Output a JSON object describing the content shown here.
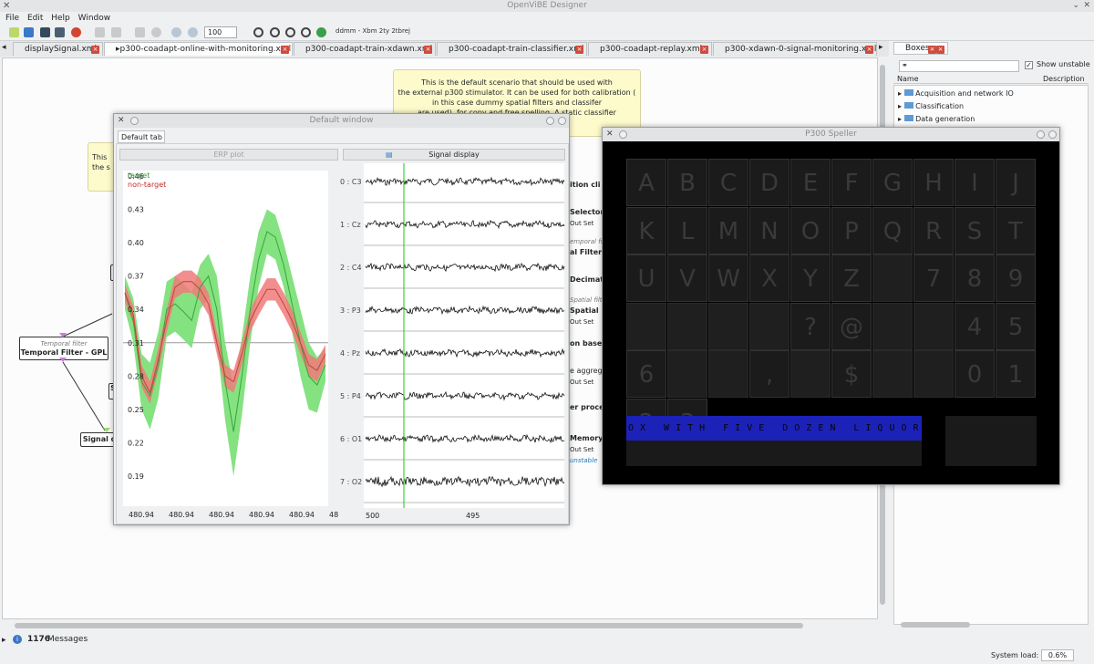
{
  "app": {
    "title": "OpenViBE Designer"
  },
  "menu": {
    "file": "File",
    "edit": "Edit",
    "help": "Help",
    "window": "Window",
    "file_m": "F",
    "file_r": "ile"
  },
  "toolbar": {
    "zoom": "100",
    "time_label": "ddmm - Xbm 2ty 2tbrej"
  },
  "tabs": [
    {
      "label": "displaySignal.xml"
    },
    {
      "label": "▸p300-coadapt-online-with-monitoring.xml"
    },
    {
      "label": "p300-coadapt-train-xdawn.xml"
    },
    {
      "label": "p300-coadapt-train-classifier.xml"
    },
    {
      "label": "p300-coadapt-replay.xml"
    },
    {
      "label": "p300-xdawn-0-signal-monitoring.xml"
    }
  ],
  "scenario": {
    "note_lines": [
      "This is the default scenario that should be used with",
      "the external p300 stimulator. It can be used for both calibration (",
      "in this case dummy spatial filters and classifer",
      "are used), for copy and free spelling. A static classifier"
    ],
    "note2_a": "This",
    "note2_b": "the s",
    "temporal_filter_sub": "Temporal filter",
    "temporal_filter_title": "Temporal Filter - GPL",
    "signal_display_box": "Signal di",
    "partial_boxes": [
      "ition cli",
      "Selector",
      "Out Set",
      "emporal filt",
      "al Filter -",
      "Decimat",
      "Spatial filte",
      "Spatial F",
      "Out Set",
      "on based c",
      "e aggreg",
      "Out Set",
      "er proce",
      "MemoryWriter",
      "Out Set",
      "unstable"
    ],
    "s1": "S",
    "g1": "G"
  },
  "default_window": {
    "title": "Default window",
    "tab": "Default tab",
    "erp_header": "ERP plot",
    "signal_header": "Signal display"
  },
  "chart_data": [
    {
      "type": "line",
      "title": "ERP plot",
      "legend": [
        "target",
        "non-target"
      ],
      "ylabels": [
        "0.46",
        "0.43",
        "0.40",
        "0.37",
        "0.34",
        "0.31",
        "0.28",
        "0.25",
        "0.22",
        "0.19"
      ],
      "xlabels": [
        "480.94",
        "480.94",
        "480.94",
        "480.94",
        "480.94",
        "48"
      ],
      "series": [
        {
          "name": "target",
          "values": [
            0.355,
            0.33,
            0.275,
            0.262,
            0.29,
            0.34,
            0.345,
            0.338,
            0.33,
            0.36,
            0.37,
            0.34,
            0.275,
            0.23,
            0.28,
            0.34,
            0.385,
            0.41,
            0.405,
            0.38,
            0.345,
            0.31,
            0.28,
            0.272,
            0.29
          ],
          "band": [
            0.015,
            0.02,
            0.025,
            0.03,
            0.03,
            0.025,
            0.025,
            0.025,
            0.025,
            0.02,
            0.02,
            0.03,
            0.035,
            0.04,
            0.035,
            0.03,
            0.025,
            0.02,
            0.02,
            0.02,
            0.025,
            0.03,
            0.03,
            0.025,
            0.015
          ]
        },
        {
          "name": "non-target",
          "values": [
            0.355,
            0.335,
            0.28,
            0.265,
            0.295,
            0.33,
            0.36,
            0.365,
            0.365,
            0.358,
            0.345,
            0.31,
            0.28,
            0.275,
            0.3,
            0.33,
            0.345,
            0.358,
            0.358,
            0.345,
            0.33,
            0.31,
            0.29,
            0.285,
            0.3
          ],
          "band": [
            0.008,
            0.008,
            0.01,
            0.01,
            0.01,
            0.01,
            0.01,
            0.01,
            0.01,
            0.01,
            0.01,
            0.01,
            0.01,
            0.01,
            0.01,
            0.01,
            0.01,
            0.01,
            0.01,
            0.01,
            0.01,
            0.01,
            0.01,
            0.01,
            0.008
          ]
        }
      ]
    },
    {
      "type": "line",
      "title": "Signal display",
      "channels": [
        "0 : C3",
        "1 : Cz",
        "2 : C4",
        "3 : P3",
        "4 : Pz",
        "5 : P4",
        "6 : O1",
        "7 : O2"
      ],
      "xlabels": [
        "500",
        "495"
      ]
    }
  ],
  "speller": {
    "title": "P300 Speller",
    "keys": [
      "A",
      "B",
      "C",
      "D",
      "E",
      "F",
      "G",
      "H",
      "I",
      "J",
      "K",
      "L",
      "M",
      "N",
      "O",
      "P",
      "Q",
      "R",
      "S",
      "T",
      "U",
      "V",
      "W",
      "X",
      "Y",
      "Z",
      "",
      "7",
      "8",
      "9",
      "",
      "",
      "",
      "",
      "?",
      "@",
      "",
      "",
      "4",
      "5",
      "6",
      "",
      "",
      ",",
      "",
      "$",
      "",
      "",
      "0",
      "1",
      "2",
      "3"
    ],
    "text": "OX WITH FIVE DOZEN LIQUOR JUGS"
  },
  "boxes_panel": {
    "title": "Boxes",
    "show_unstable": "Show unstable",
    "col_name": "Name",
    "col_desc": "Description",
    "items": [
      "Acquisition and network IO",
      "Classification",
      "Data generation"
    ]
  },
  "status": {
    "count": "1176",
    "messages": "Messages",
    "load_label": "System load:",
    "load_value": "0.6%"
  }
}
